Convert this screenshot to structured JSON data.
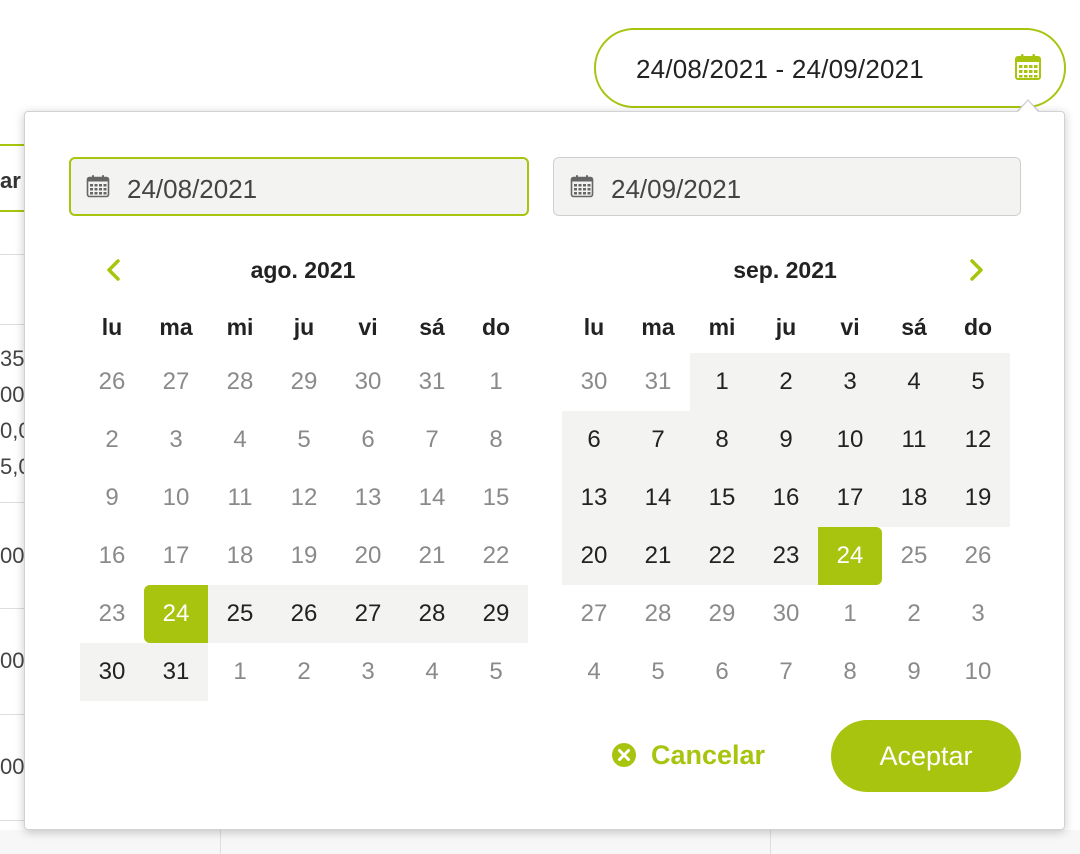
{
  "colors": {
    "accent": "#a8c40e",
    "range_bg": "#f3f3f1",
    "muted_text": "#8a8a8a"
  },
  "background": {
    "tab_label": "ar",
    "cells": [
      "35",
      "00",
      "0,0",
      "5,0",
      "00",
      "00",
      "00"
    ]
  },
  "trigger": {
    "value": "24/08/2021 - 24/09/2021",
    "icon": "calendar-icon"
  },
  "picker": {
    "start_input": "24/08/2021",
    "end_input": "24/09/2021",
    "input_icon": "calendar-icon",
    "prev_icon": "chevron-left-icon",
    "next_icon": "chevron-right-icon",
    "weekdays": [
      "lu",
      "ma",
      "mi",
      "ju",
      "vi",
      "sá",
      "do"
    ],
    "months": [
      {
        "title": "ago. 2021",
        "weeks": [
          [
            {
              "d": "26",
              "s": "out"
            },
            {
              "d": "27",
              "s": "out"
            },
            {
              "d": "28",
              "s": "out"
            },
            {
              "d": "29",
              "s": "out"
            },
            {
              "d": "30",
              "s": "out"
            },
            {
              "d": "31",
              "s": "out"
            },
            {
              "d": "1",
              "s": "out"
            }
          ],
          [
            {
              "d": "2",
              "s": "out"
            },
            {
              "d": "3",
              "s": "out"
            },
            {
              "d": "4",
              "s": "out"
            },
            {
              "d": "5",
              "s": "out"
            },
            {
              "d": "6",
              "s": "out"
            },
            {
              "d": "7",
              "s": "out"
            },
            {
              "d": "8",
              "s": "out"
            }
          ],
          [
            {
              "d": "9",
              "s": "out"
            },
            {
              "d": "10",
              "s": "out"
            },
            {
              "d": "11",
              "s": "out"
            },
            {
              "d": "12",
              "s": "out"
            },
            {
              "d": "13",
              "s": "out"
            },
            {
              "d": "14",
              "s": "out"
            },
            {
              "d": "15",
              "s": "out"
            }
          ],
          [
            {
              "d": "16",
              "s": "out"
            },
            {
              "d": "17",
              "s": "out"
            },
            {
              "d": "18",
              "s": "out"
            },
            {
              "d": "19",
              "s": "out"
            },
            {
              "d": "20",
              "s": "out"
            },
            {
              "d": "21",
              "s": "out"
            },
            {
              "d": "22",
              "s": "out"
            }
          ],
          [
            {
              "d": "23",
              "s": "out"
            },
            {
              "d": "24",
              "s": "sel"
            },
            {
              "d": "25",
              "s": "range"
            },
            {
              "d": "26",
              "s": "range"
            },
            {
              "d": "27",
              "s": "range"
            },
            {
              "d": "28",
              "s": "range"
            },
            {
              "d": "29",
              "s": "range"
            }
          ],
          [
            {
              "d": "30",
              "s": "range"
            },
            {
              "d": "31",
              "s": "range"
            },
            {
              "d": "1",
              "s": "out"
            },
            {
              "d": "2",
              "s": "out"
            },
            {
              "d": "3",
              "s": "out"
            },
            {
              "d": "4",
              "s": "out"
            },
            {
              "d": "5",
              "s": "out"
            }
          ]
        ]
      },
      {
        "title": "sep. 2021",
        "weeks": [
          [
            {
              "d": "30",
              "s": "out"
            },
            {
              "d": "31",
              "s": "out"
            },
            {
              "d": "1",
              "s": "range"
            },
            {
              "d": "2",
              "s": "range"
            },
            {
              "d": "3",
              "s": "range"
            },
            {
              "d": "4",
              "s": "range"
            },
            {
              "d": "5",
              "s": "range"
            }
          ],
          [
            {
              "d": "6",
              "s": "range"
            },
            {
              "d": "7",
              "s": "range"
            },
            {
              "d": "8",
              "s": "range"
            },
            {
              "d": "9",
              "s": "range"
            },
            {
              "d": "10",
              "s": "range"
            },
            {
              "d": "11",
              "s": "range"
            },
            {
              "d": "12",
              "s": "range"
            }
          ],
          [
            {
              "d": "13",
              "s": "range"
            },
            {
              "d": "14",
              "s": "range"
            },
            {
              "d": "15",
              "s": "range"
            },
            {
              "d": "16",
              "s": "range"
            },
            {
              "d": "17",
              "s": "range"
            },
            {
              "d": "18",
              "s": "range"
            },
            {
              "d": "19",
              "s": "range"
            }
          ],
          [
            {
              "d": "20",
              "s": "range"
            },
            {
              "d": "21",
              "s": "range"
            },
            {
              "d": "22",
              "s": "range"
            },
            {
              "d": "23",
              "s": "range"
            },
            {
              "d": "24",
              "s": "sel-end"
            },
            {
              "d": "25",
              "s": "out"
            },
            {
              "d": "26",
              "s": "out"
            }
          ],
          [
            {
              "d": "27",
              "s": "out"
            },
            {
              "d": "28",
              "s": "out"
            },
            {
              "d": "29",
              "s": "out"
            },
            {
              "d": "30",
              "s": "out"
            },
            {
              "d": "1",
              "s": "out"
            },
            {
              "d": "2",
              "s": "out"
            },
            {
              "d": "3",
              "s": "out"
            }
          ],
          [
            {
              "d": "4",
              "s": "out"
            },
            {
              "d": "5",
              "s": "out"
            },
            {
              "d": "6",
              "s": "out"
            },
            {
              "d": "7",
              "s": "out"
            },
            {
              "d": "8",
              "s": "out"
            },
            {
              "d": "9",
              "s": "out"
            },
            {
              "d": "10",
              "s": "out"
            }
          ]
        ]
      }
    ],
    "cancel_label": "Cancelar",
    "cancel_icon": "close-circle-icon",
    "accept_label": "Aceptar"
  }
}
